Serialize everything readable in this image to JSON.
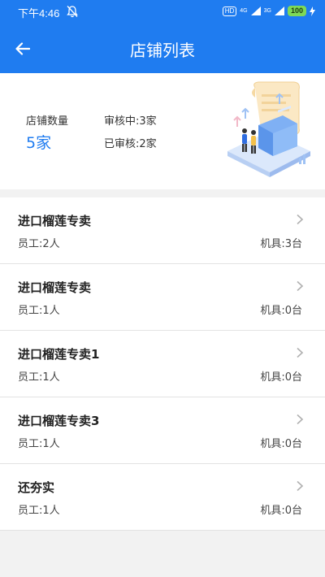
{
  "status_bar": {
    "time": "下午4:46",
    "hd": "HD",
    "net1": "4G",
    "net2": "3G",
    "battery": "100"
  },
  "header": {
    "title": "店铺列表"
  },
  "summary": {
    "count_label": "店铺数量",
    "count_value": "5家",
    "pending": "审核中:3家",
    "approved": "已审核:2家"
  },
  "stores": [
    {
      "name": "进口榴莲专卖",
      "staff": "员工:2人",
      "machines": "机具:3台"
    },
    {
      "name": "进口榴莲专卖",
      "staff": "员工:1人",
      "machines": "机具:0台"
    },
    {
      "name": "进口榴莲专卖1",
      "staff": "员工:1人",
      "machines": "机具:0台"
    },
    {
      "name": "进口榴莲专卖3",
      "staff": "员工:1人",
      "machines": "机具:0台"
    },
    {
      "name": "还夯实",
      "staff": "员工:1人",
      "machines": "机具:0台"
    }
  ],
  "icons": {
    "back": "back-arrow-icon",
    "chevron": "chevron-right-icon",
    "mute": "bell-off-icon"
  },
  "colors": {
    "primary": "#1f7cf0",
    "background": "#f2f2f2"
  }
}
